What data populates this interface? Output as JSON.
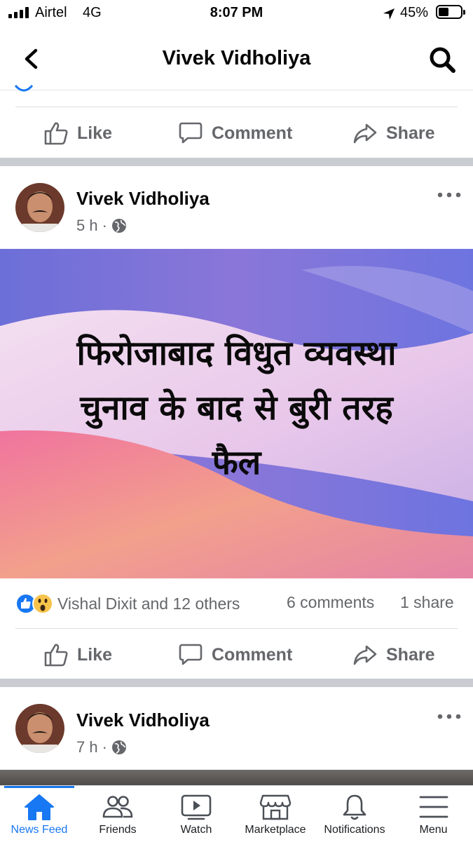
{
  "status_bar": {
    "carrier": "Airtel",
    "network": "4G",
    "time": "8:07 PM",
    "battery_percent": "45%",
    "battery_level": 0.45
  },
  "header": {
    "title": "Vivek Vidholiya"
  },
  "actions": {
    "like": "Like",
    "comment": "Comment",
    "share": "Share"
  },
  "posts": [
    {
      "author": "Vivek Vidholiya",
      "time": "5 h",
      "dot": "·",
      "image_text": [
        "फिरोजाबाद विधुत व्यवस्था",
        "चुनाव के बाद से बुरी तरह",
        "फैल"
      ],
      "reactions_text": "Vishal Dixit and 12 others",
      "comments": "6 comments",
      "shares": "1 share"
    },
    {
      "author": "Vivek Vidholiya",
      "time": "7 h",
      "dot": "·"
    }
  ],
  "nav": {
    "items": [
      {
        "label": "News Feed",
        "icon": "home-icon"
      },
      {
        "label": "Friends",
        "icon": "friends-icon"
      },
      {
        "label": "Watch",
        "icon": "watch-icon"
      },
      {
        "label": "Marketplace",
        "icon": "marketplace-icon"
      },
      {
        "label": "Notifications",
        "icon": "bell-icon"
      },
      {
        "label": "Menu",
        "icon": "menu-icon"
      }
    ]
  },
  "colors": {
    "accent": "#1877f2",
    "secondary_text": "#65676b",
    "separator": "#c9ccd1"
  }
}
